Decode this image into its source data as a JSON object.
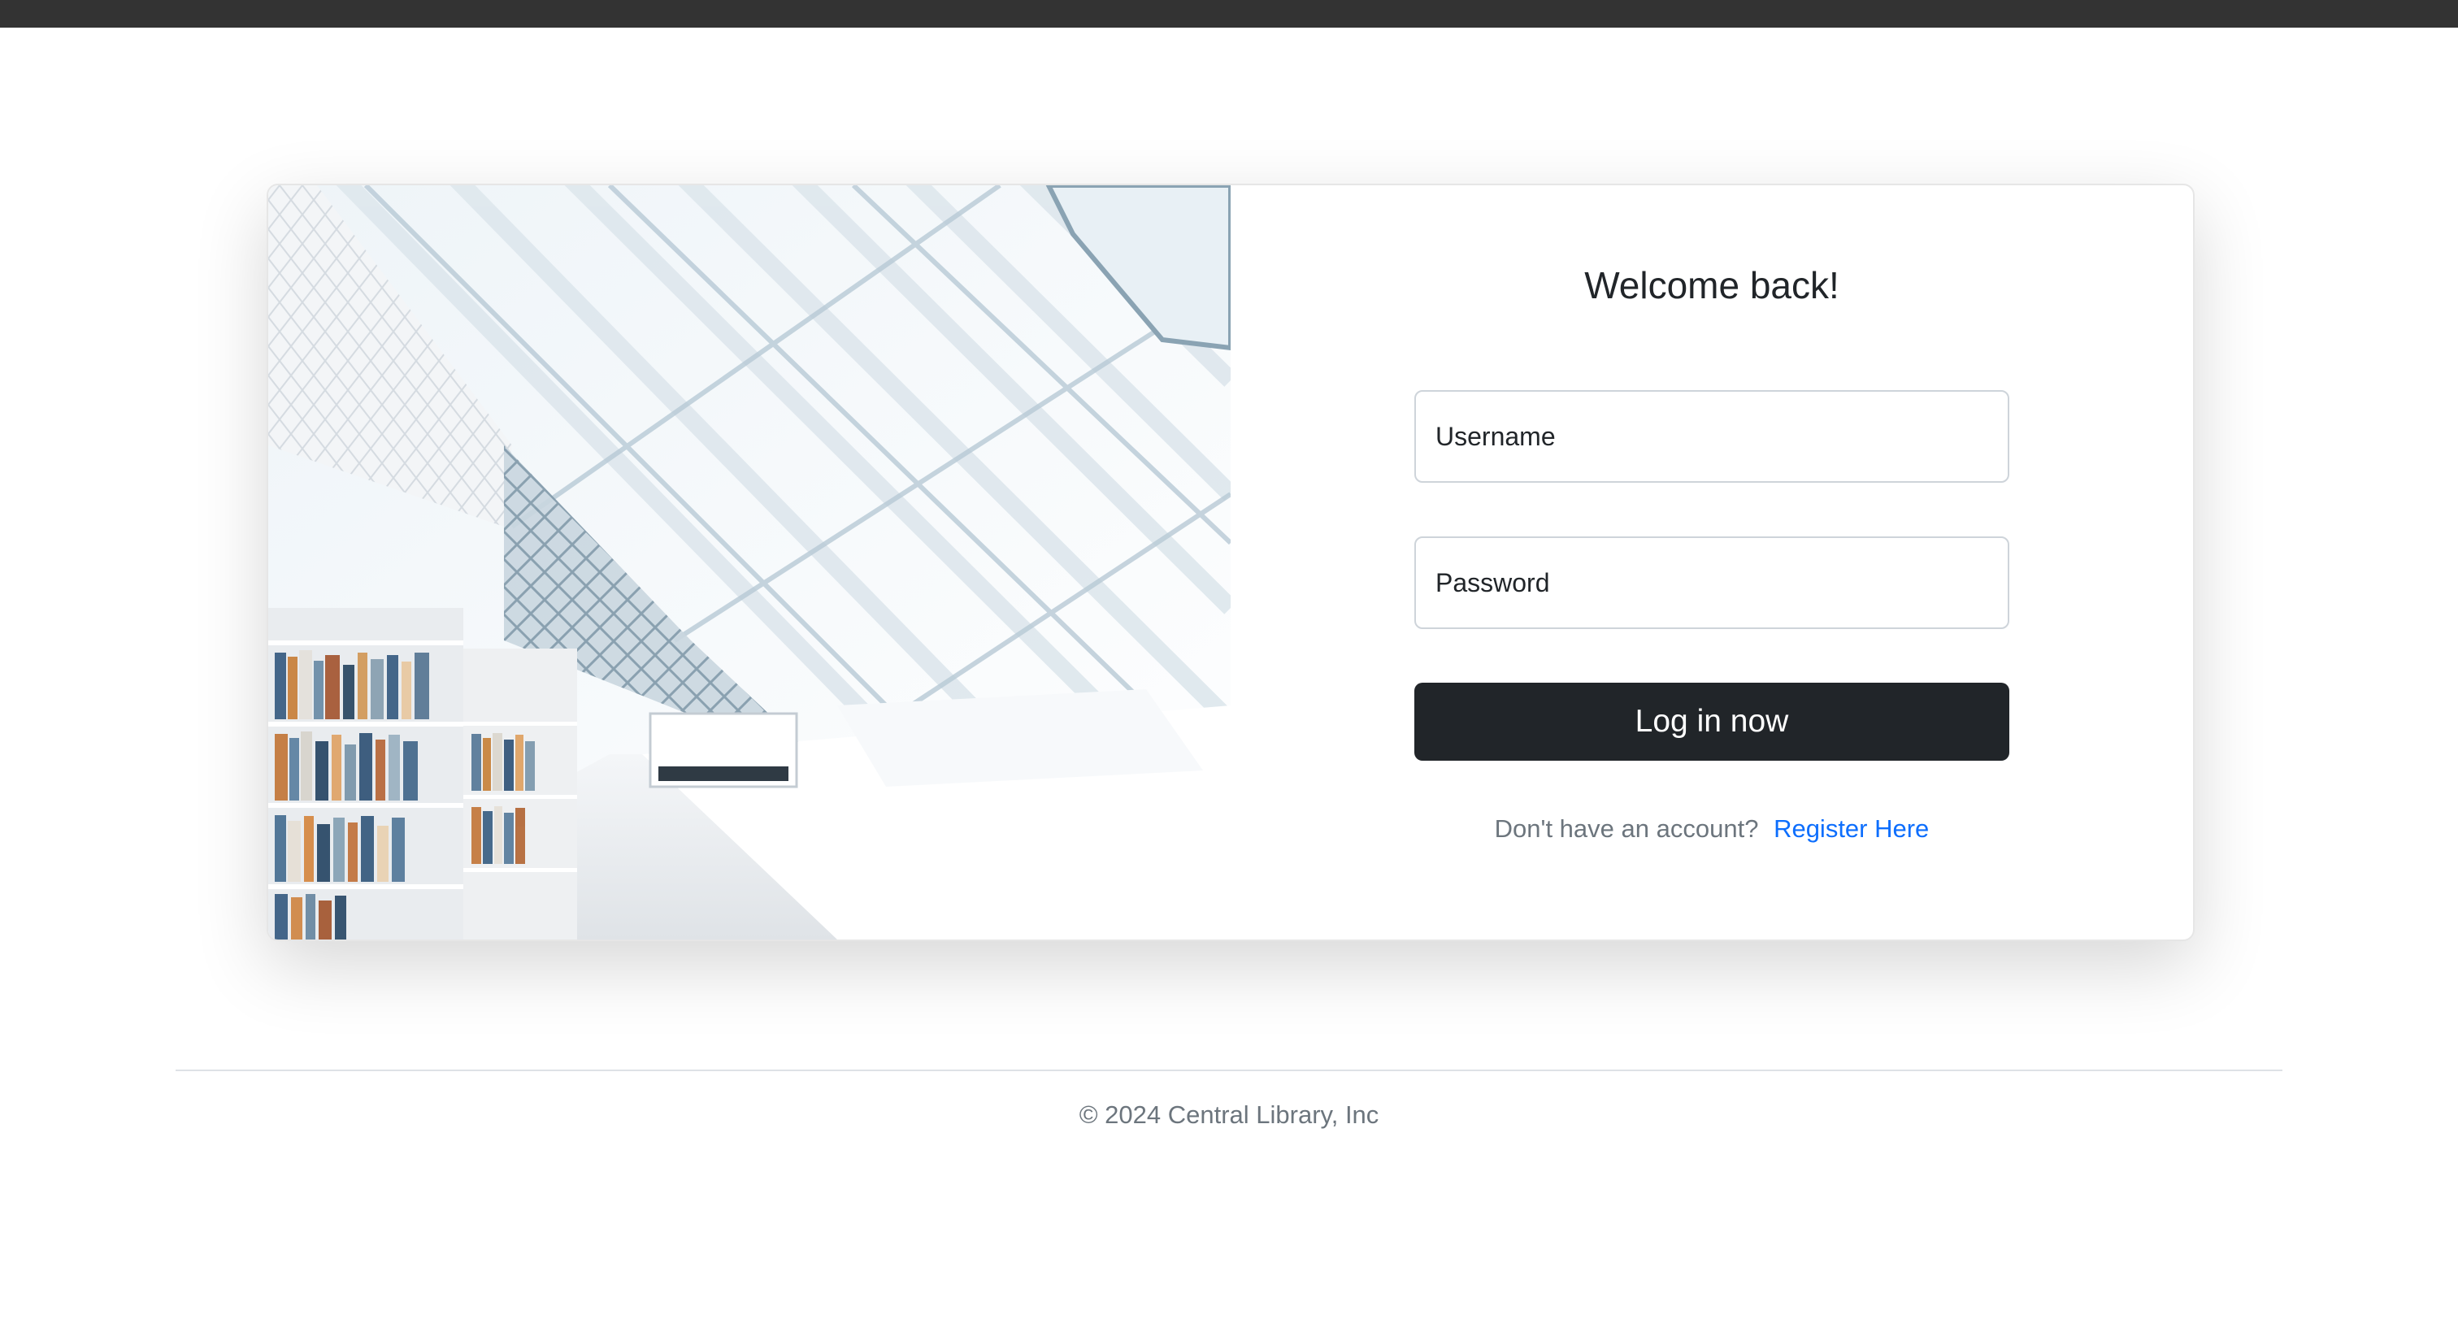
{
  "card": {
    "title": "Welcome back!",
    "hero_image_alt": "Library interior"
  },
  "form": {
    "username_placeholder": "Username",
    "password_placeholder": "Password",
    "submit_label": "Log in now",
    "register_prompt": "Don't have an account?",
    "register_link": "Register Here"
  },
  "footer": {
    "copyright": "© 2024 Central Library, Inc"
  },
  "colors": {
    "topbar": "#333333",
    "button": "#212529",
    "link": "#0d6efd",
    "muted_text": "#6c757d"
  }
}
